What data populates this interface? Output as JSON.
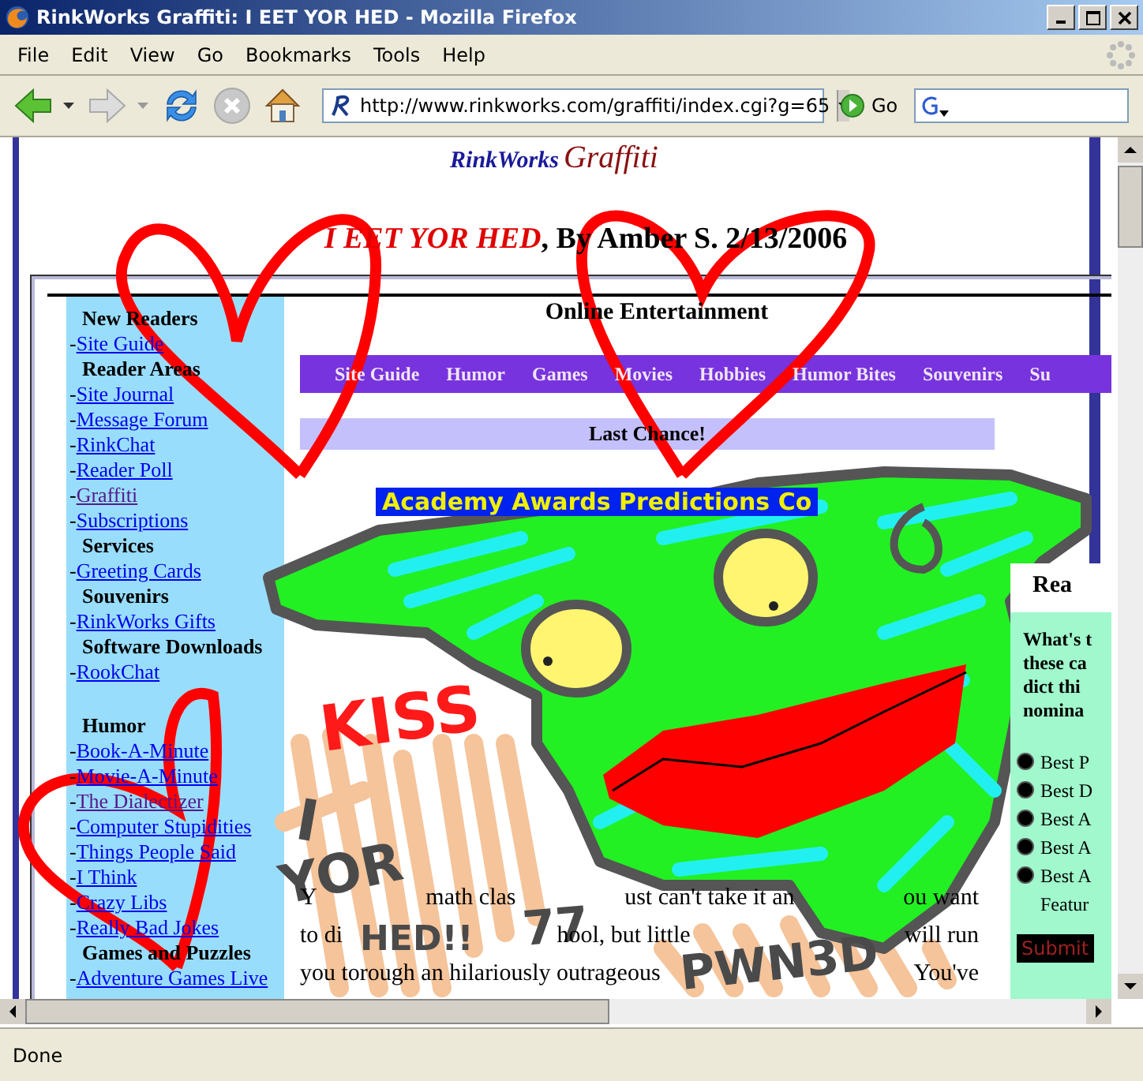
{
  "window": {
    "title": "RinkWorks Graffiti: I EET YOR HED - Mozilla Firefox"
  },
  "menu": [
    "File",
    "Edit",
    "View",
    "Go",
    "Bookmarks",
    "Tools",
    "Help"
  ],
  "toolbar": {
    "url": "http://www.rinkworks.com/graffiti/index.cgi?g=65",
    "go": "Go"
  },
  "page": {
    "logo": [
      "RinkWorks",
      "Graffiti"
    ],
    "heading": {
      "title": "I EET YOR HED",
      "byline": ", By Amber S. 2/13/2006"
    },
    "sidebar": [
      {
        "kind": "header",
        "text": "New Readers"
      },
      {
        "kind": "link",
        "dash": "-",
        "text": "Site Guide",
        "visited": false
      },
      {
        "kind": "header",
        "text": "Reader Areas"
      },
      {
        "kind": "link",
        "dash": "-",
        "text": "Site Journal",
        "visited": false
      },
      {
        "kind": "link",
        "dash": "-",
        "text": "Message Forum",
        "visited": false
      },
      {
        "kind": "link",
        "dash": "-",
        "text": "RinkChat",
        "visited": false
      },
      {
        "kind": "link",
        "dash": "-",
        "text": "Reader Poll",
        "visited": false
      },
      {
        "kind": "link",
        "dash": "-",
        "text": "Graffiti",
        "visited": true
      },
      {
        "kind": "link",
        "dash": "-",
        "text": "Subscriptions",
        "visited": false
      },
      {
        "kind": "header",
        "text": "Services"
      },
      {
        "kind": "link",
        "dash": "-",
        "text": "Greeting Cards",
        "visited": false
      },
      {
        "kind": "header",
        "text": "Souvenirs"
      },
      {
        "kind": "link",
        "dash": "-",
        "text": "RinkWorks Gifts",
        "visited": false
      },
      {
        "kind": "header",
        "text": "Software Downloads"
      },
      {
        "kind": "link",
        "dash": "-",
        "text": "RookChat",
        "visited": false
      },
      {
        "kind": "gap"
      },
      {
        "kind": "header",
        "text": "Humor"
      },
      {
        "kind": "link",
        "dash": "-",
        "text": "Book-A-Minute",
        "visited": false
      },
      {
        "kind": "link",
        "dash": "-",
        "text": "Movie-A-Minute",
        "visited": false
      },
      {
        "kind": "link",
        "dash": "-",
        "text": "The Dialectizer",
        "visited": true
      },
      {
        "kind": "link",
        "dash": "-",
        "text": "Computer Stupidities",
        "visited": false
      },
      {
        "kind": "link",
        "dash": "-",
        "text": "Things People Said",
        "visited": false
      },
      {
        "kind": "link",
        "dash": "-",
        "text": "I Think",
        "visited": false
      },
      {
        "kind": "link",
        "dash": "-",
        "text": "Crazy Libs",
        "visited": false
      },
      {
        "kind": "link",
        "dash": "-",
        "text": "Really Bad Jokes",
        "visited": false
      },
      {
        "kind": "header",
        "text": "Games and Puzzles"
      },
      {
        "kind": "link",
        "dash": "-",
        "text": "Adventure Games Live",
        "visited": false
      }
    ],
    "site_title": "Online Entertainment",
    "nav": [
      "Site Guide",
      "Humor",
      "Games",
      "Movies",
      "Hobbies",
      "Humor Bites",
      "Souvenirs",
      "Su"
    ],
    "last_chance": "Last Chance!",
    "banner": "Academy Awards Predictions Co",
    "poll": {
      "title": "Rea",
      "question": [
        "What's t",
        "these ca",
        "dict thi",
        "nomina"
      ],
      "options": [
        {
          "label": "Best P",
          "selected": false
        },
        {
          "label": "Best D",
          "selected": false
        },
        {
          "label": "Best A",
          "selected": false
        },
        {
          "label": "Best A",
          "selected": false
        },
        {
          "label": "Best A Featur",
          "selected": false
        }
      ],
      "submit": "Submit"
    },
    "paragraph": [
      [
        "Y",
        "math clas",
        "ust can't take it an",
        "ou want"
      ],
      [
        "to di",
        "hool, but little",
        "will run"
      ],
      [
        "you torough an hilariously outrageous",
        "You've"
      ]
    ],
    "graffiti": [
      "KISS",
      "I",
      "YOR",
      "HED!!",
      "77",
      "PWN3D"
    ]
  },
  "status_bar": "Done"
}
